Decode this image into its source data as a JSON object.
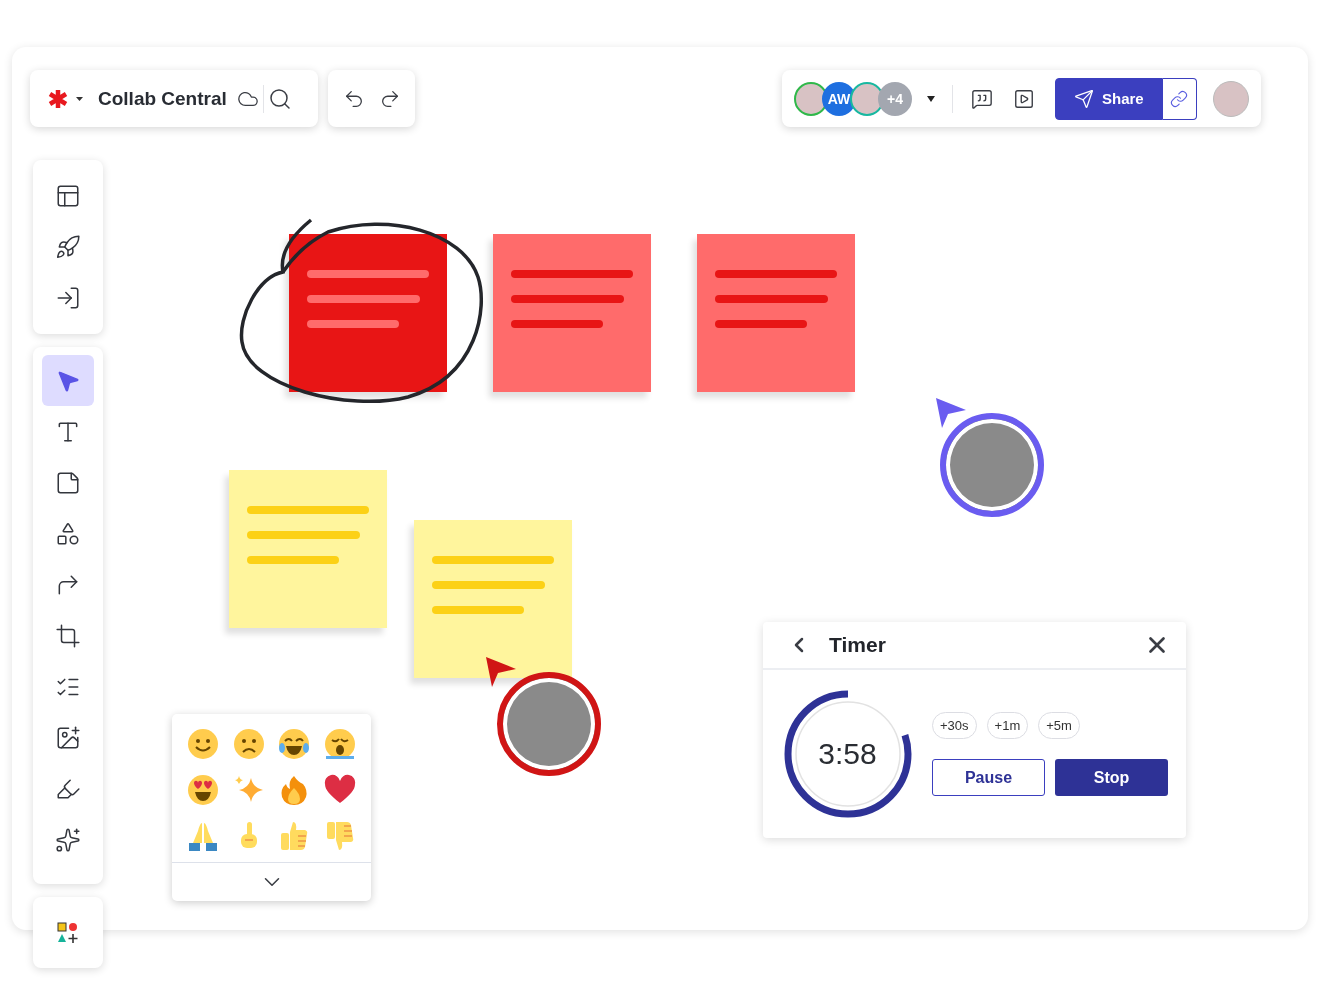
{
  "header": {
    "title": "Collab Central"
  },
  "collaborators": [
    {
      "kind": "photo",
      "color": "#2fb84a"
    },
    {
      "kind": "initials",
      "label": "AW",
      "color": "#1e6fe0"
    },
    {
      "kind": "photo",
      "color": "#17b8a0"
    },
    {
      "kind": "count",
      "label": "+4",
      "color": "#a3a7b0"
    }
  ],
  "share": {
    "label": "Share"
  },
  "tool_groups": [
    [
      {
        "kind": "templates",
        "selected": false
      },
      {
        "kind": "launch",
        "selected": false
      },
      {
        "kind": "import",
        "selected": false
      }
    ],
    [
      {
        "kind": "select",
        "selected": true
      },
      {
        "kind": "text",
        "selected": false
      },
      {
        "kind": "sticky",
        "selected": false
      },
      {
        "kind": "shapes",
        "selected": false
      },
      {
        "kind": "connector",
        "selected": false
      },
      {
        "kind": "frame",
        "selected": false
      },
      {
        "kind": "list",
        "selected": false
      },
      {
        "kind": "image",
        "selected": false
      },
      {
        "kind": "pen",
        "selected": false
      },
      {
        "kind": "ai",
        "selected": false
      }
    ],
    [
      {
        "kind": "apps",
        "selected": false
      }
    ]
  ],
  "stickies": [
    {
      "kind": "deep",
      "color": "#e81515",
      "circled": true
    },
    {
      "kind": "pale",
      "color": "#ff6b6b",
      "circled": false
    },
    {
      "kind": "pale",
      "color": "#ff6b6b",
      "circled": false
    },
    {
      "kind": "yellow",
      "color": "#fff59d",
      "circled": false
    },
    {
      "kind": "yellow",
      "color": "#fff59d",
      "circled": false
    }
  ],
  "cursors": [
    {
      "color": "#6a5cf0"
    },
    {
      "color": "#d01515"
    }
  ],
  "timer": {
    "title": "Timer",
    "time": "3:58",
    "level": 0.8,
    "increments": [
      "+30s",
      "+1m",
      "+5m"
    ],
    "pause": "Pause",
    "stop": "Stop"
  }
}
